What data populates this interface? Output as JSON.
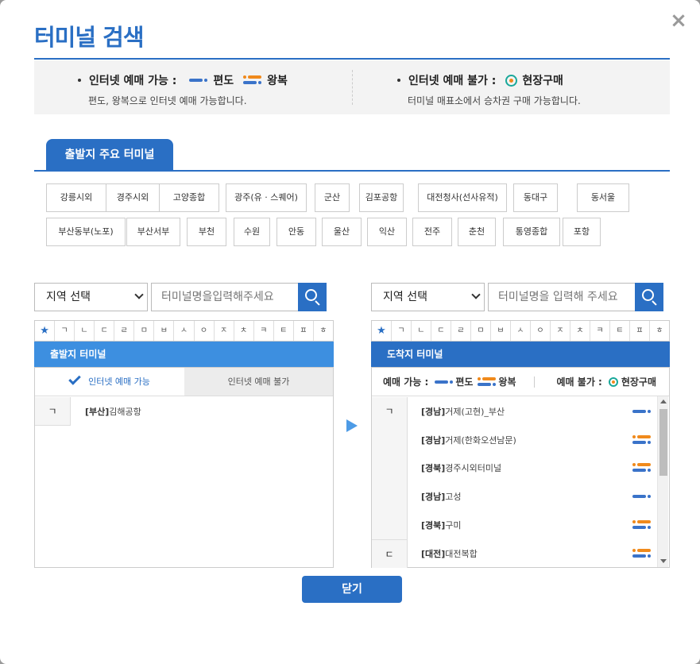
{
  "modal": {
    "title": "터미널 검색",
    "close_button": "닫기"
  },
  "info": {
    "left_head": "인터넷 예매 가능 :",
    "oneway": "편도",
    "round": "왕복",
    "left_sub": "편도, 왕복으로 인터넷 예매 가능합니다.",
    "right_head": "인터넷 예매 불가 :",
    "onsite": "현장구매",
    "right_sub": "터미널 매표소에서 승차권 구매 가능합니다."
  },
  "tab": {
    "label": "출발지 주요 터미널"
  },
  "terminals": [
    [
      "강릉시외",
      "경주시외",
      "고양종합",
      "광주(유 · 스퀘어)",
      "군산",
      "김포공항",
      "대전청사(선사유적)",
      "동대구",
      "동서울"
    ],
    [
      "부산동부(노포)",
      "부산서부",
      "부천",
      "수원",
      "안동",
      "울산",
      "익산",
      "전주",
      "춘천",
      "통영종합",
      "포항"
    ]
  ],
  "departure": {
    "region_select": "지역 선택",
    "search_placeholder": "터미널명을입력해주세요",
    "panel_title": "출발지 터미널",
    "subtab_available": "인터넷 예매 가능",
    "subtab_unavailable": "인터넷 예매 불가",
    "rows": [
      {
        "initial": "ㄱ",
        "region": "[부산]",
        "name": "김해공항"
      }
    ]
  },
  "arrival": {
    "region_select": "지역 선택",
    "search_placeholder": "터미널명을 입력해 주세요",
    "panel_title": "도착지 터미널",
    "legend_available": "예매 가능 :",
    "legend_oneway": "편도",
    "legend_round": "왕복",
    "legend_unavailable": "예매 불가 :",
    "legend_onsite": "현장구매",
    "rows": [
      {
        "initial": "ㄱ",
        "region": "[경남]",
        "name": "거제(고현)_부산",
        "icon": "oneway"
      },
      {
        "initial": "",
        "region": "[경남]",
        "name": "거제(한화오션남문)",
        "icon": "round"
      },
      {
        "initial": "",
        "region": "[경북]",
        "name": "경주시외터미널",
        "icon": "round"
      },
      {
        "initial": "",
        "region": "[경남]",
        "name": "고성",
        "icon": "oneway"
      },
      {
        "initial": "",
        "region": "[경북]",
        "name": "구미",
        "icon": "round"
      },
      {
        "initial": "ㄷ",
        "region": "[대전]",
        "name": "대전복합",
        "icon": "round"
      }
    ]
  },
  "consonants": [
    "★",
    "ㄱ",
    "ㄴ",
    "ㄷ",
    "ㄹ",
    "ㅁ",
    "ㅂ",
    "ㅅ",
    "ㅇ",
    "ㅈ",
    "ㅊ",
    "ㅋ",
    "ㅌ",
    "ㅍ",
    "ㅎ"
  ],
  "colors": {
    "primary": "#2a6fc4",
    "departure_header": "#3d8fe0",
    "arrival_header": "#2a6fc4",
    "oneway_icon": "#3a73c9",
    "round_icon": "#f08a1c",
    "onsite_ring": "#1aa89a"
  }
}
